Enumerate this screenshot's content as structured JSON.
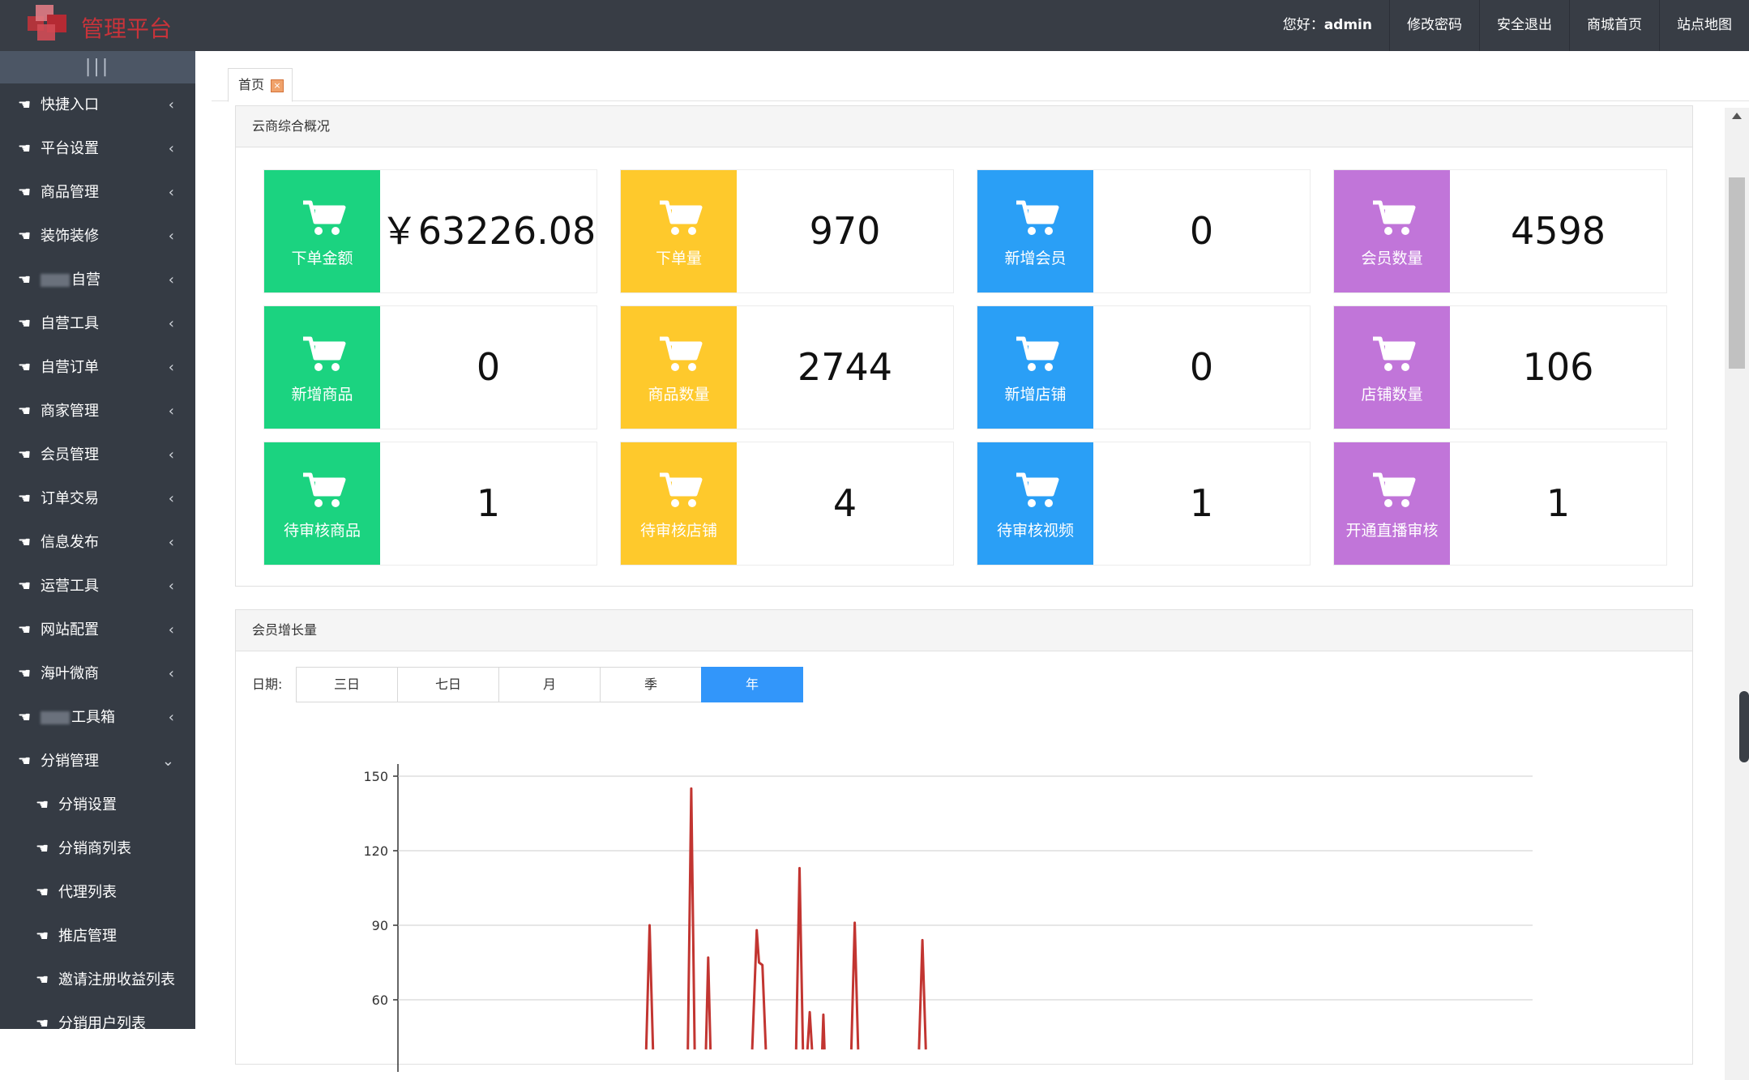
{
  "header": {
    "logo_text": "管理平台",
    "greeting_prefix": "您好：",
    "username": "admin",
    "nav": [
      "修改密码",
      "安全退出",
      "商城首页",
      "站点地图"
    ]
  },
  "sidebar": {
    "collapse_icon": "bars-icon",
    "items": [
      {
        "label": "快捷入口"
      },
      {
        "label": "平台设置"
      },
      {
        "label": "商品管理"
      },
      {
        "label": "装饰装修"
      },
      {
        "label": "自营",
        "redacted_prefix": true
      },
      {
        "label": "自营工具"
      },
      {
        "label": "自营订单"
      },
      {
        "label": "商家管理"
      },
      {
        "label": "会员管理"
      },
      {
        "label": "订单交易"
      },
      {
        "label": "信息发布"
      },
      {
        "label": "运营工具"
      },
      {
        "label": "网站配置"
      },
      {
        "label": "海叶微商"
      },
      {
        "label": "工具箱",
        "redacted_prefix": true
      },
      {
        "label": "分销管理",
        "expanded": true
      }
    ],
    "sub_items": [
      "分销设置",
      "分销商列表",
      "代理列表",
      "推店管理",
      "邀请注册收益列表",
      "分销用户列表"
    ]
  },
  "tabs": [
    {
      "label": "首页",
      "close_icon": "close-icon"
    }
  ],
  "overview": {
    "title": "云商综合概况",
    "colors": {
      "green": "#1bd380",
      "yellow": "#fec92c",
      "blue": "#2a9ff6",
      "purple": "#c175d9"
    },
    "cards": [
      {
        "label": "下单金额",
        "value": "￥63226.08",
        "color": "green"
      },
      {
        "label": "下单量",
        "value": "970",
        "color": "yellow"
      },
      {
        "label": "新增会员",
        "value": "0",
        "color": "blue"
      },
      {
        "label": "会员数量",
        "value": "4598",
        "color": "purple"
      },
      {
        "label": "新增商品",
        "value": "0",
        "color": "green"
      },
      {
        "label": "商品数量",
        "value": "2744",
        "color": "yellow"
      },
      {
        "label": "新增店铺",
        "value": "0",
        "color": "blue"
      },
      {
        "label": "店铺数量",
        "value": "106",
        "color": "purple"
      },
      {
        "label": "待审核商品",
        "value": "1",
        "color": "green"
      },
      {
        "label": "待审核店铺",
        "value": "4",
        "color": "yellow"
      },
      {
        "label": "待审核视频",
        "value": "1",
        "color": "blue"
      },
      {
        "label": "开通直播审核",
        "value": "1",
        "color": "purple"
      }
    ]
  },
  "growth": {
    "title": "会员增长量",
    "date_label": "日期:",
    "periods": [
      "三日",
      "七日",
      "月",
      "季",
      "年"
    ],
    "active_period": "年",
    "chart_data": {
      "type": "line",
      "y_ticks": [
        60,
        90,
        120,
        150
      ],
      "ylim": [
        60,
        150
      ],
      "line_color": "#c23531",
      "segments": [
        [
          [
            0.2188,
            40
          ],
          [
            0.2218,
            90
          ],
          [
            0.2248,
            40
          ]
        ],
        [
          [
            0.2555,
            40
          ],
          [
            0.2585,
            145
          ],
          [
            0.2615,
            40
          ]
        ],
        [
          [
            0.2714,
            40
          ],
          [
            0.2734,
            77
          ],
          [
            0.2754,
            40
          ]
        ],
        [
          [
            0.3122,
            40
          ],
          [
            0.3162,
            88
          ],
          [
            0.3182,
            75
          ],
          [
            0.3212,
            74
          ],
          [
            0.3242,
            40
          ]
        ],
        [
          [
            0.3509,
            40
          ],
          [
            0.3539,
            113
          ],
          [
            0.3569,
            40
          ]
        ],
        [
          [
            0.3609,
            40
          ],
          [
            0.3629,
            55
          ],
          [
            0.3649,
            40
          ]
        ],
        [
          [
            0.3739,
            40
          ],
          [
            0.3749,
            54
          ],
          [
            0.3759,
            40
          ]
        ],
        [
          [
            0.3996,
            40
          ],
          [
            0.4026,
            91
          ],
          [
            0.4056,
            40
          ]
        ],
        [
          [
            0.4592,
            40
          ],
          [
            0.4622,
            84
          ],
          [
            0.4652,
            40
          ]
        ]
      ]
    }
  }
}
